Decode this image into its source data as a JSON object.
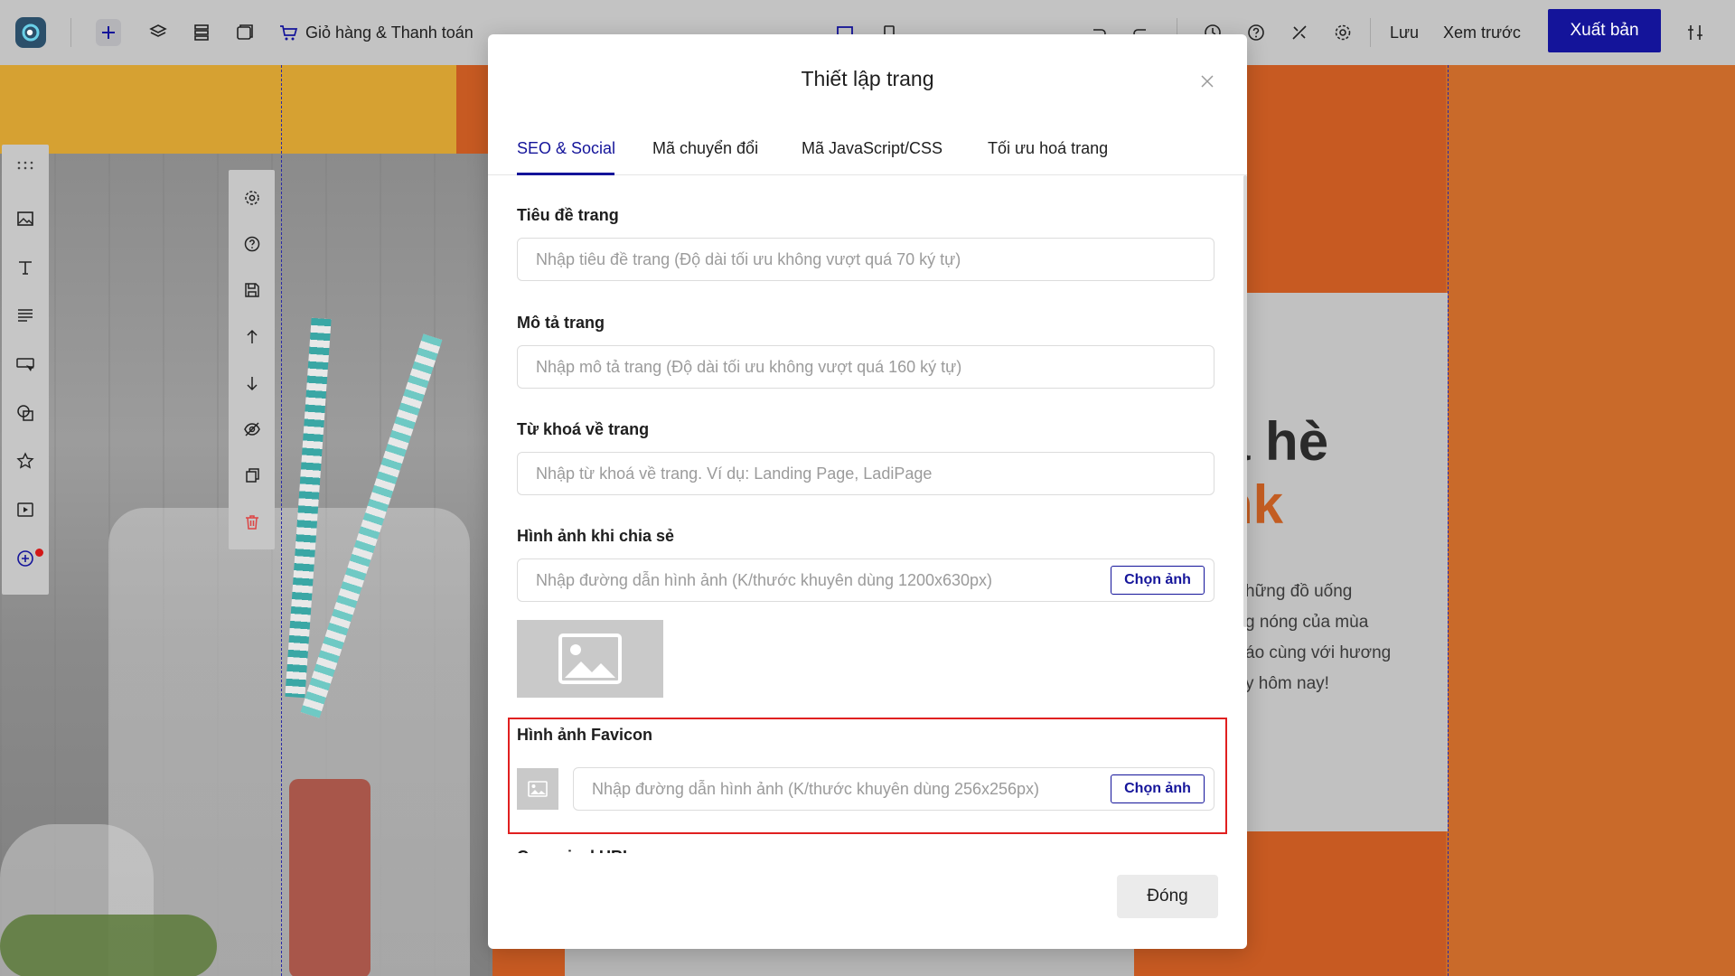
{
  "toolbar": {
    "cart_label": "Giỏ hàng & Thanh toán",
    "save_label": "Lưu",
    "preview_label": "Xem trước",
    "publish_label": "Xuất bản",
    "icons": [
      "logo-icon",
      "add-icon",
      "layers-icon",
      "sections-icon",
      "popup-icon",
      "cart-icon",
      "desktop-view-icon",
      "mobile-view-icon",
      "undo-icon",
      "redo-icon",
      "history-icon",
      "help-icon",
      "tools-icon",
      "settings-icon",
      "adjust-icon"
    ]
  },
  "canvas": {
    "heading_line1": "a hè",
    "heading_line2": "nk",
    "paragraph": [
      "hững đồ uống",
      "g nóng của mùa",
      "áo cùng với hương",
      "y hôm nay!"
    ],
    "colors": {
      "orange": "#c75a22",
      "yellow": "#d6a132",
      "accent_text": "#c35d22"
    }
  },
  "left_sidebar": {
    "icons": [
      "drag-handle-icon",
      "image-icon",
      "text-icon",
      "paragraph-icon",
      "button-icon",
      "shape-icon",
      "star-icon",
      "video-icon",
      "add-more-icon"
    ]
  },
  "section_tools": {
    "icons": [
      "section-settings-icon",
      "section-help-icon",
      "section-save-icon",
      "move-up-icon",
      "move-down-icon",
      "hide-icon",
      "duplicate-icon",
      "delete-icon"
    ]
  },
  "modal": {
    "title": "Thiết lập trang",
    "tabs": [
      {
        "label": "SEO & Social",
        "active": true
      },
      {
        "label": "Mã chuyển đổi",
        "active": false
      },
      {
        "label": "Mã JavaScript/CSS",
        "active": false
      },
      {
        "label": "Tối ưu hoá trang",
        "active": false
      }
    ],
    "fields": {
      "page_title": {
        "label": "Tiêu đề trang",
        "placeholder": "Nhập tiêu đề trang (Độ dài tối ưu không vượt quá 70 ký tự)",
        "value": ""
      },
      "page_description": {
        "label": "Mô tả trang",
        "placeholder": "Nhập mô tả trang (Độ dài tối ưu không vượt quá 160 ký tự)",
        "value": ""
      },
      "page_keywords": {
        "label": "Từ khoá về trang",
        "placeholder": "Nhập từ khoá về trang. Ví dụ: Landing Page, LadiPage",
        "value": ""
      },
      "share_image": {
        "label": "Hình ảnh khi chia sẻ",
        "placeholder": "Nhập đường dẫn hình ảnh (K/thước khuyên dùng 1200x630px)",
        "value": "",
        "button": "Chọn ảnh"
      },
      "favicon": {
        "label": "Hình ảnh Favicon",
        "placeholder": "Nhập đường dẫn hình ảnh (K/thước khuyên dùng 256x256px)",
        "value": "",
        "button": "Chọn ảnh"
      },
      "next_label_partial": "Canonical URL"
    },
    "close_button": "Đóng",
    "colors": {
      "primary": "#14149a",
      "highlight_border": "#e02020"
    }
  }
}
